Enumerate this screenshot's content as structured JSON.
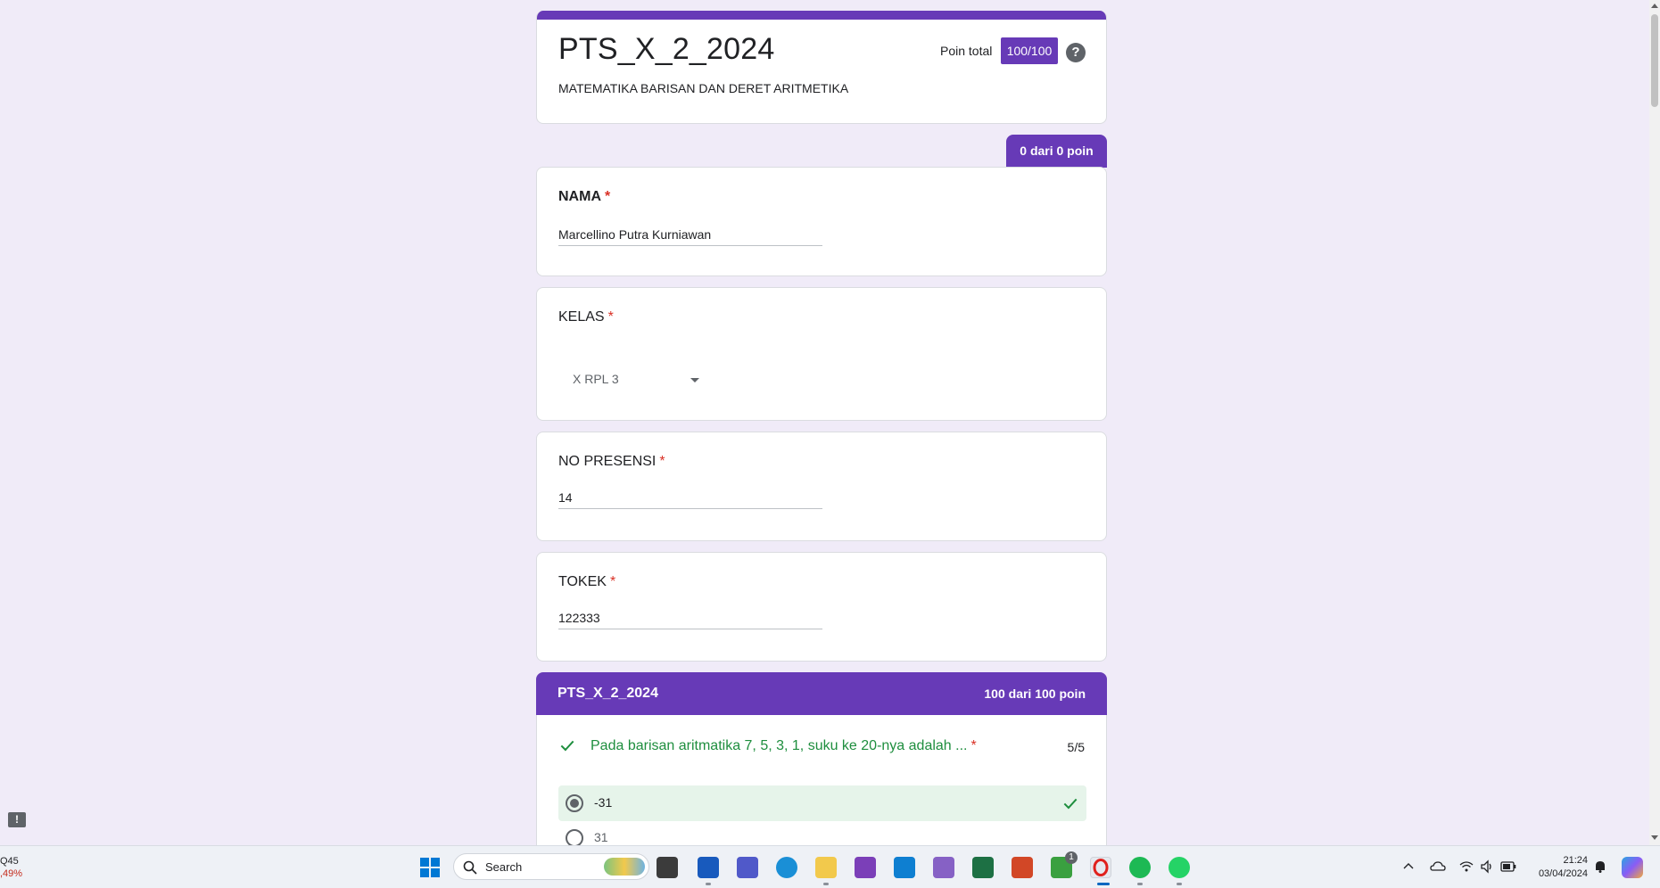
{
  "form": {
    "title": "PTS_X_2_2024",
    "description": "MATEMATIKA BARISAN DAN DERET ARITMETIKA",
    "total_label": "Poin total",
    "total_value": "100/100"
  },
  "score_tab": "0 dari 0 poin",
  "questions": {
    "nama": {
      "label": "NAMA",
      "required": "*",
      "value": "Marcellino Putra Kurniawan"
    },
    "kelas": {
      "label": "KELAS",
      "required": "*",
      "value": "X RPL 3"
    },
    "presensi": {
      "label": "NO PRESENSI",
      "required": "*",
      "value": "14"
    },
    "tokek": {
      "label": "TOKEK",
      "required": "*",
      "value": "122333"
    }
  },
  "section": {
    "title": "PTS_X_2_2024",
    "score": "100 dari 100 poin",
    "q1": {
      "text": "Pada barisan aritmatika 7, 5, 3, 1, suku ke 20-nya adalah ...",
      "required": "*",
      "points": "5/5",
      "options": [
        "-31",
        "31"
      ]
    }
  },
  "taskbar": {
    "stock_code": "Q45",
    "stock_change": ",49%",
    "search_label": "Search",
    "badge_count": "1",
    "time": "21:24",
    "date": "03/04/2024"
  },
  "colors": {
    "accent": "#673ab7",
    "background": "#f0ebf8",
    "correct_green": "#1e8e3e",
    "required_red": "#d93025"
  }
}
